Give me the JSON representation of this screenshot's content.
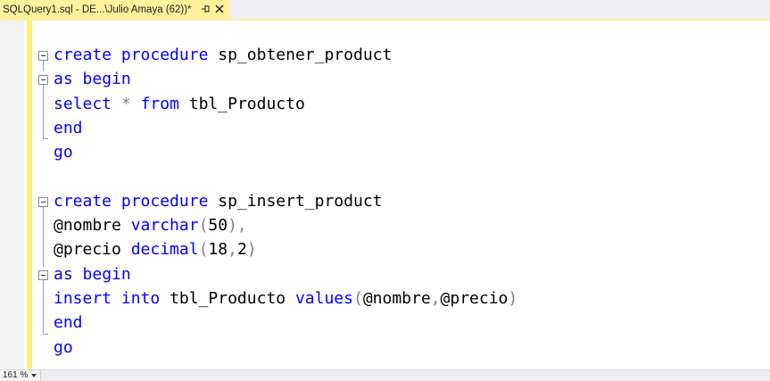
{
  "tab": {
    "title": "SQLQuery1.sql - DE...\\Julio Amaya (62))*"
  },
  "code": [
    [
      {
        "t": "create",
        "c": "kw"
      },
      {
        "t": " ",
        "c": "pl"
      },
      {
        "t": "procedure",
        "c": "kw"
      },
      {
        "t": " sp_obtener_product",
        "c": "pl"
      }
    ],
    [
      {
        "t": "as",
        "c": "kw"
      },
      {
        "t": " ",
        "c": "pl"
      },
      {
        "t": "begin",
        "c": "kw"
      }
    ],
    [
      {
        "t": "select",
        "c": "kw"
      },
      {
        "t": " ",
        "c": "pl"
      },
      {
        "t": "*",
        "c": "pn"
      },
      {
        "t": " ",
        "c": "pl"
      },
      {
        "t": "from",
        "c": "kw"
      },
      {
        "t": " tbl_Producto",
        "c": "pl"
      }
    ],
    [
      {
        "t": "end",
        "c": "kw"
      }
    ],
    [
      {
        "t": "go",
        "c": "kw"
      }
    ],
    [],
    [
      {
        "t": "create",
        "c": "kw"
      },
      {
        "t": " ",
        "c": "pl"
      },
      {
        "t": "procedure",
        "c": "kw"
      },
      {
        "t": " sp_insert_product",
        "c": "pl"
      }
    ],
    [
      {
        "t": "@nombre ",
        "c": "pl"
      },
      {
        "t": "varchar",
        "c": "tp"
      },
      {
        "t": "(",
        "c": "pn"
      },
      {
        "t": "50",
        "c": "pl"
      },
      {
        "t": "),",
        "c": "pn"
      }
    ],
    [
      {
        "t": "@precio ",
        "c": "pl"
      },
      {
        "t": "decimal",
        "c": "tp"
      },
      {
        "t": "(",
        "c": "pn"
      },
      {
        "t": "18",
        "c": "pl"
      },
      {
        "t": ",",
        "c": "pn"
      },
      {
        "t": "2",
        "c": "pl"
      },
      {
        "t": ")",
        "c": "pn"
      }
    ],
    [
      {
        "t": "as",
        "c": "kw"
      },
      {
        "t": " ",
        "c": "pl"
      },
      {
        "t": "begin",
        "c": "kw"
      }
    ],
    [
      {
        "t": "insert",
        "c": "kw"
      },
      {
        "t": " ",
        "c": "pl"
      },
      {
        "t": "into",
        "c": "kw"
      },
      {
        "t": " tbl_Producto ",
        "c": "pl"
      },
      {
        "t": "values",
        "c": "kw"
      },
      {
        "t": "(",
        "c": "pn"
      },
      {
        "t": "@nombre",
        "c": "pl"
      },
      {
        "t": ",",
        "c": "pn"
      },
      {
        "t": "@precio",
        "c": "pl"
      },
      {
        "t": ")",
        "c": "pn"
      }
    ],
    [
      {
        "t": "end",
        "c": "kw"
      }
    ],
    [
      {
        "t": "go",
        "c": "kw"
      }
    ]
  ],
  "status": {
    "zoom": "161 %"
  },
  "colors": {
    "keyword": "#0000ff",
    "operator": "#808080",
    "tab_active": "#fff29d",
    "change_bar": "#ffef74"
  },
  "icons": {
    "pin": "pin-icon",
    "close": "close-icon",
    "fold": "collapse-icon"
  }
}
